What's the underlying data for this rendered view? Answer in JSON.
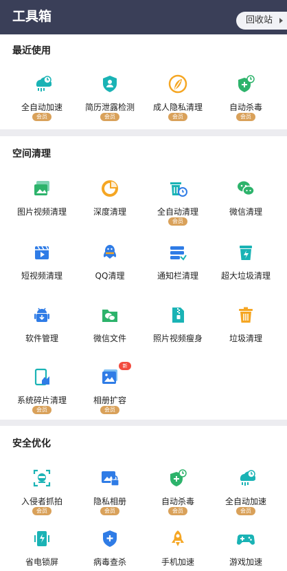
{
  "header": {
    "title": "工具箱",
    "recycle_label": "回收站"
  },
  "vip_label": "会员",
  "new_badge": "新",
  "colors": {
    "header_bg": "#3a3f58",
    "teal": "#1ab3b5",
    "blue": "#2f7ce6",
    "orange": "#f5a623",
    "green": "#2db36b",
    "vip": "#d9a15a"
  },
  "sections": {
    "recent": {
      "title": "最近使用",
      "items": [
        {
          "label": "全自动加速",
          "icon": "auto-speed-icon",
          "vip": true
        },
        {
          "label": "简历泄露检测",
          "icon": "resume-shield-icon",
          "vip": true
        },
        {
          "label": "成人隐私清理",
          "icon": "privacy-leaf-icon",
          "vip": true
        },
        {
          "label": "自动杀毒",
          "icon": "auto-antivirus-icon",
          "vip": true
        }
      ]
    },
    "space": {
      "title": "空间清理",
      "items": [
        {
          "label": "图片视频清理",
          "icon": "image-clean-icon",
          "vip": false
        },
        {
          "label": "深度清理",
          "icon": "deep-clean-pie-icon",
          "vip": false
        },
        {
          "label": "全自动清理",
          "icon": "auto-clean-trash-icon",
          "vip": true
        },
        {
          "label": "微信清理",
          "icon": "wechat-icon",
          "vip": false
        },
        {
          "label": "短视频清理",
          "icon": "short-video-icon",
          "vip": false
        },
        {
          "label": "QQ清理",
          "icon": "qq-icon",
          "vip": false
        },
        {
          "label": "通知栏清理",
          "icon": "notification-icon",
          "vip": false
        },
        {
          "label": "超大垃圾清理",
          "icon": "big-trash-icon",
          "vip": false
        },
        {
          "label": "软件管理",
          "icon": "android-icon",
          "vip": false
        },
        {
          "label": "微信文件",
          "icon": "wechat-folder-icon",
          "vip": false
        },
        {
          "label": "照片视频瘦身",
          "icon": "zip-file-icon",
          "vip": false
        },
        {
          "label": "垃圾清理",
          "icon": "trash-icon",
          "vip": false
        },
        {
          "label": "系统碎片清理",
          "icon": "fragment-clean-icon",
          "vip": true
        },
        {
          "label": "相册扩容",
          "icon": "album-expand-icon",
          "vip": true,
          "new": true
        }
      ]
    },
    "security": {
      "title": "安全优化",
      "items": [
        {
          "label": "入侵者抓拍",
          "icon": "intruder-capture-icon",
          "vip": true
        },
        {
          "label": "隐私相册",
          "icon": "private-album-icon",
          "vip": true
        },
        {
          "label": "自动杀毒",
          "icon": "auto-antivirus-icon",
          "vip": true
        },
        {
          "label": "全自动加速",
          "icon": "auto-speed-icon",
          "vip": true
        },
        {
          "label": "省电锁屏",
          "icon": "battery-save-icon",
          "vip": false
        },
        {
          "label": "病毒查杀",
          "icon": "virus-shield-icon",
          "vip": false
        },
        {
          "label": "手机加速",
          "icon": "rocket-icon",
          "vip": false
        },
        {
          "label": "游戏加速",
          "icon": "gamepad-icon",
          "vip": false
        }
      ]
    }
  }
}
